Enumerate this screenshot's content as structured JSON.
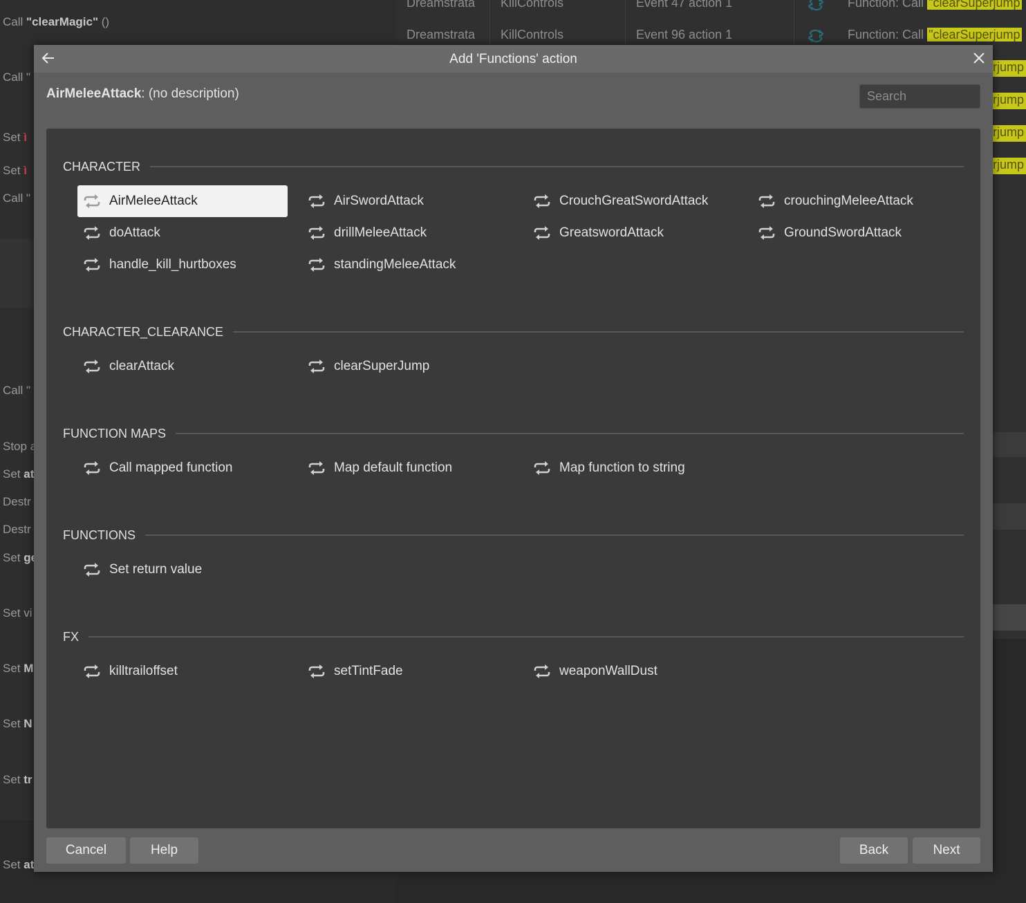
{
  "background": {
    "left_rows": [
      {
        "prefix": "Call ",
        "bold": "\"clearMagic\"",
        "suffix": " ()",
        "hl": ""
      },
      {
        "prefix": "Call \"",
        "bold": "",
        "suffix": "",
        "hl": ""
      },
      {
        "prefix": "Set ",
        "bold": "",
        "suffix": "",
        "hl": "ì"
      },
      {
        "prefix": "Set ",
        "bold": "",
        "suffix": "",
        "hl": "ì"
      },
      {
        "prefix": "Call \"",
        "bold": "",
        "suffix": "",
        "hl": ""
      },
      {
        "prefix": "Call \"",
        "bold": "",
        "suffix": "",
        "hl": ""
      },
      {
        "prefix": "Stop a",
        "bold": "",
        "suffix": "",
        "hl": ""
      },
      {
        "prefix": "Set ",
        "bold": "at",
        "suffix": "",
        "hl": ""
      },
      {
        "prefix": "Destr",
        "bold": "",
        "suffix": "",
        "hl": ""
      },
      {
        "prefix": "Destr",
        "bold": "",
        "suffix": "",
        "hl": ""
      },
      {
        "prefix": "Set ",
        "bold": "ge",
        "suffix": "",
        "hl": ""
      },
      {
        "prefix": "Set vi",
        "bold": "",
        "suffix": "",
        "hl": ""
      },
      {
        "prefix": "Set ",
        "bold": "M",
        "suffix": "",
        "hl": ""
      },
      {
        "prefix": "Set ",
        "bold": "N",
        "suffix": "",
        "hl": ""
      },
      {
        "prefix": "Set ",
        "bold": "tr",
        "suffix": "",
        "hl": ""
      },
      {
        "prefix": "Set ",
        "bold": "at",
        "suffix": "",
        "hl": ""
      }
    ],
    "right_rows": [
      {
        "sheet": "Dreamstrata",
        "layout": "KillControls",
        "event": "Event 47 action 1",
        "fn": "Function: Call ",
        "hl": "\"clearSuperjump"
      },
      {
        "sheet": "Dreamstrata",
        "layout": "KillControls",
        "event": "Event 96 action 1",
        "fn": "Function: Call ",
        "hl": "\"clearSuperjump"
      }
    ],
    "right_fragments": [
      "rjump",
      "rjump",
      "rjump",
      "rjump"
    ]
  },
  "dialog": {
    "title": "Add 'Functions' action",
    "description_name": "AirMeleeAttack",
    "description_text": ": (no description)",
    "search_placeholder": "Search",
    "sections": [
      {
        "label": "CHARACTER",
        "items": [
          "AirMeleeAttack",
          "AirSwordAttack",
          "CrouchGreatSwordAttack",
          "crouchingMeleeAttack",
          "doAttack",
          "drillMeleeAttack",
          "GreatswordAttack",
          "GroundSwordAttack",
          "handle_kill_hurtboxes",
          "standingMeleeAttack"
        ]
      },
      {
        "label": "CHARACTER_CLEARANCE",
        "items": [
          "clearAttack",
          "clearSuperJump"
        ]
      },
      {
        "label": "FUNCTION MAPS",
        "items": [
          "Call mapped function",
          "Map default function",
          "Map function to string"
        ]
      },
      {
        "label": "FUNCTIONS",
        "items": [
          "Set return value"
        ]
      },
      {
        "label": "FX",
        "items": [
          "killtrailoffset",
          "setTintFade",
          "weaponWallDust"
        ]
      }
    ],
    "selected_item": "AirMeleeAttack",
    "item_icon": "repeat-arrows-icon",
    "buttons": {
      "cancel": "Cancel",
      "help": "Help",
      "back": "Back",
      "next": "Next"
    }
  },
  "colors": {
    "modal": "#5e5e5e",
    "panel": "#3a3a3a",
    "selected": "#f2f2f2",
    "highlight": "#c8c81a"
  }
}
